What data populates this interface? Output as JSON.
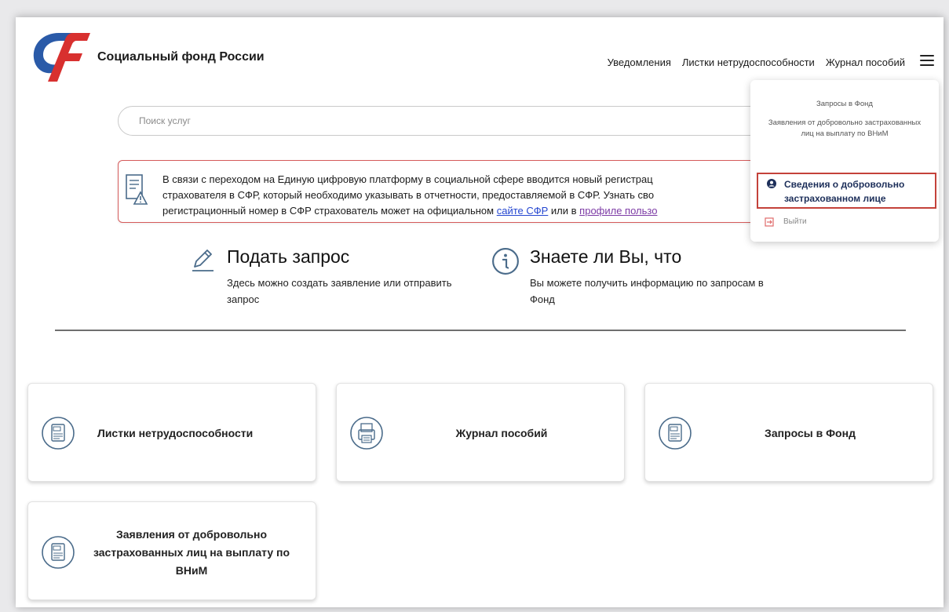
{
  "header": {
    "brand": "Социальный фонд России",
    "nav": [
      "Уведомления",
      "Листки нетрудоспособности",
      "Журнал пособий"
    ],
    "brand_colors": {
      "blue": "#2a5aa8",
      "red": "#d8302f"
    }
  },
  "search": {
    "placeholder": "Поиск услуг"
  },
  "notice": {
    "line1": "В связи с переходом на Единую цифровую платформу в социальной сфере вводится новый регистрац",
    "line2": "страхователя в СФР, который необходимо указывать в отчетности, предоставляемой в СФР. Узнать сво",
    "line3_prefix": "регистрационный номер в СФР страхователь может на официальном ",
    "link1": "сайте СФР",
    "line3_middle": " или в ",
    "link2": "профиле пользо"
  },
  "info_blocks": [
    {
      "title": "Подать запрос",
      "description": "Здесь можно создать заявление или отправить запрос"
    },
    {
      "title": "Знаете ли Вы, что",
      "description": "Вы можете получить информацию по запросам в Фонд"
    }
  ],
  "cards": [
    {
      "title": "Листки нетрудоспособности"
    },
    {
      "title": "Журнал пособий"
    },
    {
      "title": "Запросы в Фонд"
    },
    {
      "title": "Заявления от добровольно застрахованных лиц на выплату по ВНиМ"
    }
  ],
  "dropdown": {
    "items": [
      "Запросы в Фонд",
      "Заявления от добровольно застрахованных лиц на выплату по ВНиМ"
    ],
    "highlighted": "Сведения о добровольно застрахованном лице",
    "exit": "Выйти",
    "highlight_color": "#c4423a"
  }
}
